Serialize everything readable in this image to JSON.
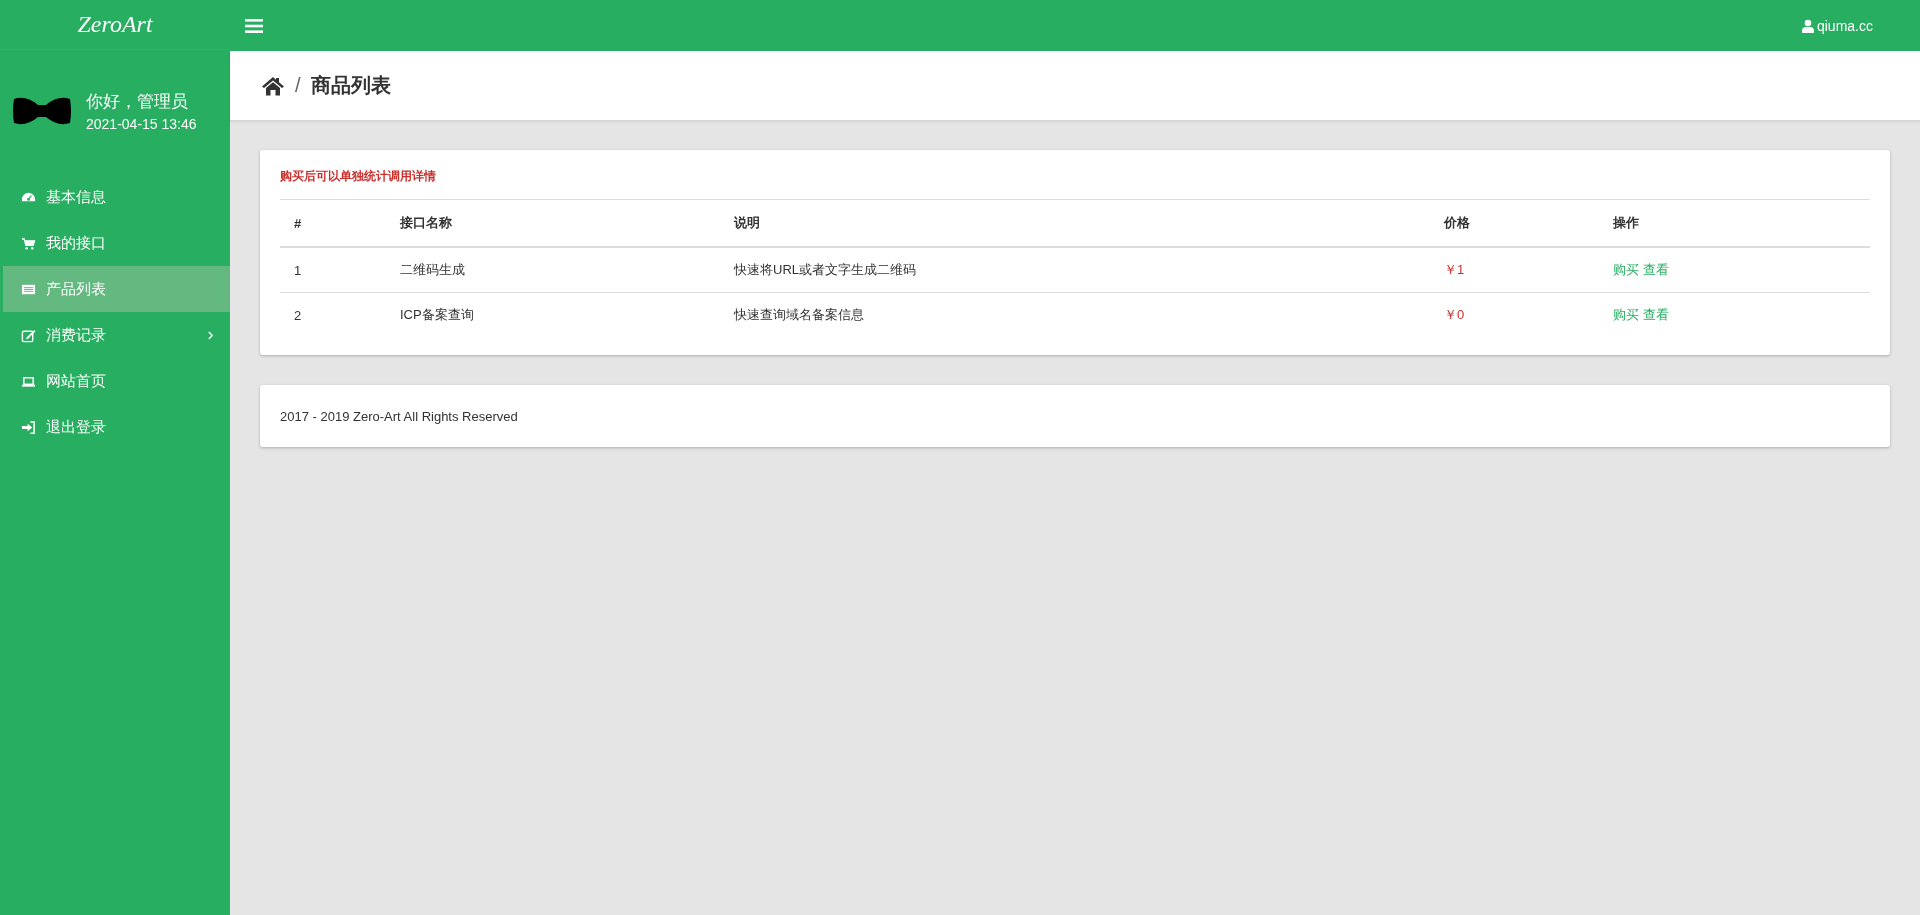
{
  "logo": "ZeroArt",
  "user_menu": {
    "label": "qiuma.cc"
  },
  "profile": {
    "greeting": "你好，管理员",
    "datetime": "2021-04-15 13:46"
  },
  "sidebar": {
    "items": [
      {
        "label": "基本信息",
        "selected": false,
        "has_submenu": false
      },
      {
        "label": "我的接口",
        "selected": false,
        "has_submenu": false
      },
      {
        "label": "产品列表",
        "selected": true,
        "has_submenu": false
      },
      {
        "label": "消费记录",
        "selected": false,
        "has_submenu": true
      },
      {
        "label": "网站首页",
        "selected": false,
        "has_submenu": false
      },
      {
        "label": "退出登录",
        "selected": false,
        "has_submenu": false
      }
    ]
  },
  "breadcrumb": {
    "separator": "/",
    "title": "商品列表"
  },
  "notice": "购买后可以单独统计调用详情",
  "table": {
    "columns": [
      "#",
      "接口名称",
      "说明",
      "价格",
      "操作"
    ],
    "rows": [
      {
        "index": "1",
        "name": "二维码生成",
        "description": "快速将URL或者文字生成二维码",
        "price": "￥1",
        "actions": [
          "购买",
          "查看"
        ]
      },
      {
        "index": "2",
        "name": "ICP备案查询",
        "description": "快速查询域名备案信息",
        "price": "￥0",
        "actions": [
          "购买",
          "查看"
        ]
      }
    ]
  },
  "footer": "2017 - 2019 Zero-Art All Rights Reserved"
}
